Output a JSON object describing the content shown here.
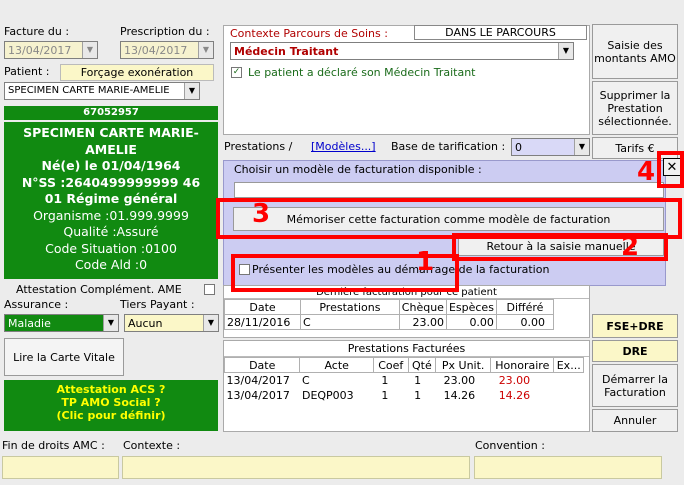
{
  "left": {
    "facture_label": "Facture du :",
    "facture_date": "13/04/2017",
    "prescription_label": "Prescription du :",
    "prescription_date": "13/04/2017",
    "patient_label": "Patient :",
    "forcage_button": "Forçage exonération",
    "patient_name": "SPECIMEN CARTE MARIE-AMELIE",
    "patient_number": "67052957",
    "card": {
      "name_line1": "SPECIMEN CARTE MARIE-",
      "name_line2": "AMELIE",
      "born": "Né(e) le 01/04/1964",
      "nss": "N°SS :2640499999999 46",
      "regime": "01 Régime général",
      "organisme": "Organisme :01.999.9999",
      "qualite": "Qualité :Assuré",
      "code_situation": "Code Situation :0100",
      "code_ald": "Code Ald :0"
    },
    "attestation_amc": "Attestation Complément. AME",
    "assurance_label": "Assurance :",
    "tiers_label": "Tiers Payant :",
    "assurance_value": "Maladie",
    "tiers_value": "Aucun",
    "lire_carte": "Lire la Carte Vitale",
    "acs_line1": "Attestation ACS ?",
    "acs_line2": "TP AMO Social ?",
    "acs_line3": "(Clic pour définir)"
  },
  "context": {
    "label": "Contexte Parcours de Soins",
    "parcours": "DANS LE PARCOURS",
    "medecin": "Médecin Traitant",
    "declared": "Le patient a déclaré son Médecin Traitant"
  },
  "prestations_bar": {
    "label": "Prestations /",
    "modeles_link": "[Modèles...]",
    "base_label": "Base de tarification :",
    "base_value": "0"
  },
  "modele_panel": {
    "choose_label": "Choisir un modèle de facturation disponible :",
    "memoriser": "Mémoriser cette facturation comme modèle de facturation",
    "retour": "Retour à la saisie manuelle",
    "presenter": "Présenter les modèles au démarrage de la facturation"
  },
  "last_billing": {
    "title": "Dernière facturation pour ce patient",
    "headers": [
      "Date",
      "Prestations",
      "Chèque",
      "Espèces",
      "Différé"
    ],
    "row": [
      "28/11/2016",
      "C",
      "23.00",
      "0.00",
      "0.00"
    ]
  },
  "billed": {
    "title": "Prestations Facturées",
    "headers": [
      "Date",
      "Acte",
      "Coef",
      "Qté",
      "Px Unit.",
      "Honoraire",
      "Ex..."
    ],
    "rows": [
      [
        "13/04/2017",
        "C",
        "1",
        "1",
        "23.00",
        "23.00"
      ],
      [
        "13/04/2017",
        "DEQP003",
        "1",
        "1",
        "14.26",
        "14.26"
      ]
    ]
  },
  "right_buttons": {
    "saisie": "Saisie des montants AMO",
    "supprimer": "Supprimer la Prestation sélectionnée.",
    "tarifs": "Tarifs €",
    "close": "✕",
    "fse": "FSE+DRE",
    "dre": "DRE",
    "demarrer": "Démarrer la Facturation",
    "annuler": "Annuler"
  },
  "bottom": {
    "fin_droits": "Fin de droits AMC :",
    "contexte": "Contexte :",
    "convention": "Convention :"
  },
  "annotations": [
    "1",
    "2",
    "3",
    "4"
  ],
  "colors": {
    "annotation": "#ff0000",
    "card_green": "#118a11",
    "yellow_field": "#fbf7c8",
    "honoraire_red": "#cc0000"
  }
}
